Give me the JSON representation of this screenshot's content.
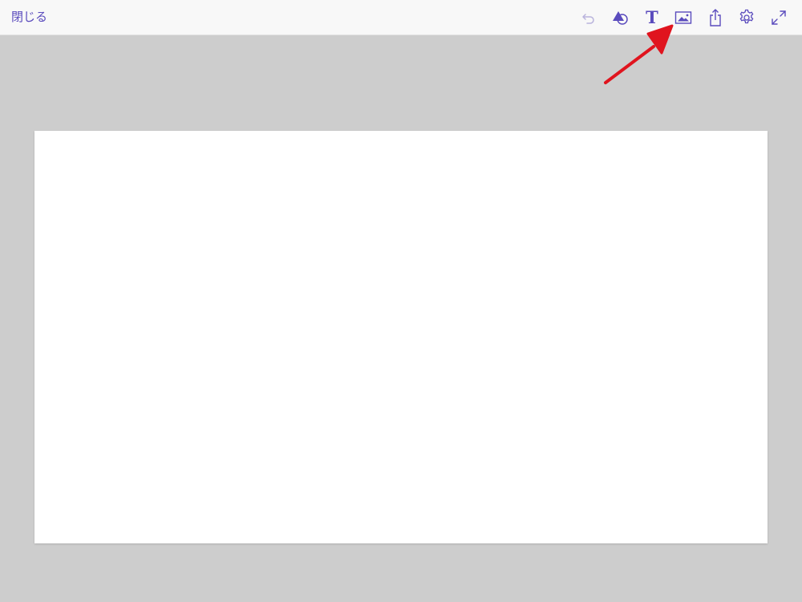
{
  "toolbar": {
    "close_label": "閉じる",
    "accent_color": "#5a4bbd",
    "tools": [
      {
        "name": "undo-icon",
        "enabled": false
      },
      {
        "name": "shapes-icon",
        "enabled": true
      },
      {
        "name": "text-icon",
        "enabled": true,
        "glyph": "T"
      },
      {
        "name": "image-icon",
        "enabled": true
      },
      {
        "name": "share-icon",
        "enabled": true
      },
      {
        "name": "settings-icon",
        "enabled": true
      },
      {
        "name": "fullscreen-icon",
        "enabled": true
      }
    ]
  },
  "annotation": {
    "arrow_color": "#e0141e",
    "points_to": "image-icon"
  },
  "canvas": {
    "background": "#ffffff"
  }
}
